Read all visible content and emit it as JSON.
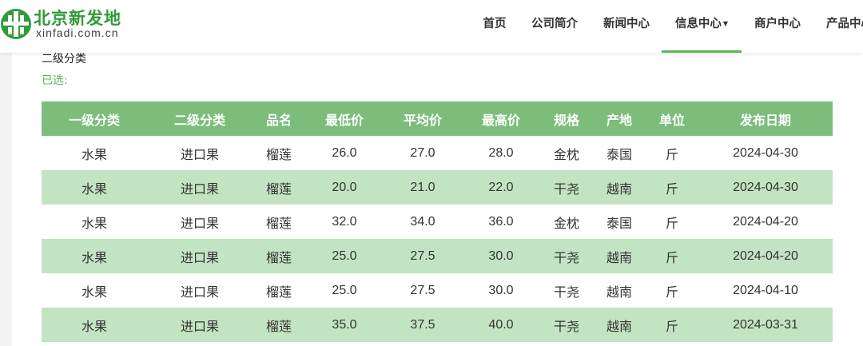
{
  "colors": {
    "brand_green": "#2f9b39",
    "header_row": "#7cbd7b",
    "stripe_row": "#c3e4c2",
    "active_underline": "#5cb85c"
  },
  "site": {
    "name_cn": "北京新发地",
    "domain": "xinfadi.com.cn",
    "logo_icon": "xinfadi-logo-icon"
  },
  "nav": {
    "items": [
      {
        "label": "首页"
      },
      {
        "label": "公司简介"
      },
      {
        "label": "新闻中心"
      },
      {
        "label": "信息中心",
        "has_dropdown": true
      },
      {
        "label": "商户中心"
      },
      {
        "label": "产品中心"
      }
    ],
    "active": "信息中心"
  },
  "filters": {
    "level2_label": "二级分类",
    "selected_label": "已选:"
  },
  "table": {
    "headers": [
      "一级分类",
      "二级分类",
      "品名",
      "最低价",
      "平均价",
      "最高价",
      "规格",
      "产地",
      "单位",
      "发布日期"
    ],
    "rows": [
      [
        "水果",
        "进口果",
        "榴莲",
        "26.0",
        "27.0",
        "28.0",
        "金枕",
        "泰国",
        "斤",
        "2024-04-30"
      ],
      [
        "水果",
        "进口果",
        "榴莲",
        "20.0",
        "21.0",
        "22.0",
        "干尧",
        "越南",
        "斤",
        "2024-04-30"
      ],
      [
        "水果",
        "进口果",
        "榴莲",
        "32.0",
        "34.0",
        "36.0",
        "金枕",
        "泰国",
        "斤",
        "2024-04-20"
      ],
      [
        "水果",
        "进口果",
        "榴莲",
        "25.0",
        "27.5",
        "30.0",
        "干尧",
        "越南",
        "斤",
        "2024-04-20"
      ],
      [
        "水果",
        "进口果",
        "榴莲",
        "25.0",
        "27.5",
        "30.0",
        "干尧",
        "越南",
        "斤",
        "2024-04-10"
      ],
      [
        "水果",
        "进口果",
        "榴莲",
        "35.0",
        "37.5",
        "40.0",
        "干尧",
        "越南",
        "斤",
        "2024-03-31"
      ]
    ]
  }
}
